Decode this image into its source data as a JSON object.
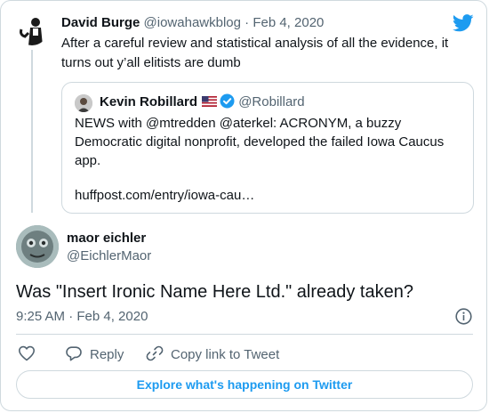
{
  "parent_tweet": {
    "author_name": "David Burge",
    "author_handle": "@iowahawkblog",
    "separator": "·",
    "date": "Feb 4, 2020",
    "text": "After a careful review and statistical analysis of all the evidence, it turns out y’all elitists are dumb"
  },
  "quoted_tweet": {
    "author_name": "Kevin Robillard",
    "author_handle": "@Robillard",
    "text": "NEWS with @mtredden @aterkel: ACRONYM, a buzzy Democratic digital nonprofit, developed the failed Iowa Caucus app.",
    "link": "huffpost.com/entry/iowa-cau…"
  },
  "main_tweet": {
    "author_name": "maor eichler",
    "author_handle": "@EichlerMaor",
    "text": "Was \"Insert Ironic Name Here Ltd.\" already taken?",
    "timestamp": "9:25 AM · Feb 4, 2020"
  },
  "actions": {
    "reply_label": "Reply",
    "copy_link_label": "Copy link to Tweet"
  },
  "explore_button": {
    "label": "Explore what's happening on Twitter"
  },
  "icons": {
    "brand": "twitter-bird-icon",
    "like": "heart-icon",
    "reply": "reply-icon",
    "copy": "link-icon",
    "info": "info-icon",
    "verified": "verified-badge-icon",
    "flag": "us-flag-icon"
  },
  "colors": {
    "twitter_blue": "#1d9bf0",
    "muted_text": "#536471",
    "border": "#cfd9de"
  }
}
